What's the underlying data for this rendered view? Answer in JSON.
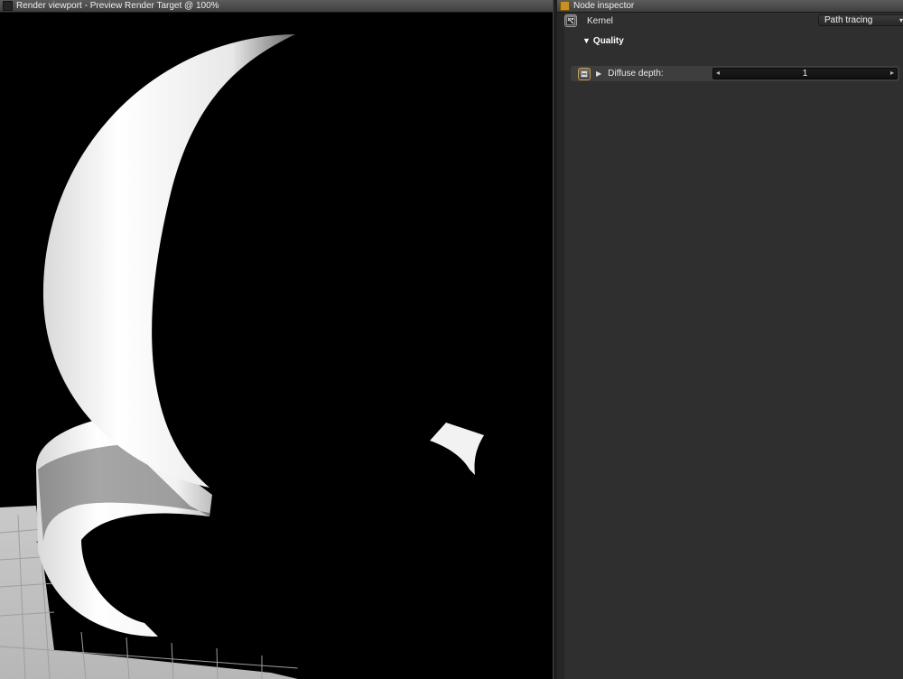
{
  "viewport": {
    "title": "Render viewport - Preview Render Target @ 100%"
  },
  "inspector": {
    "title": "Node inspector",
    "kernel": {
      "label": "Kernel",
      "value": "Path tracing"
    },
    "quality": {
      "label": "Quality"
    },
    "diffuse_depth": {
      "label": "Diffuse depth:",
      "value": "1"
    }
  },
  "icons": {
    "viewport_header": "square-icon",
    "inspector_header": "node-icon",
    "kernel_node": "node-graph-icon",
    "depth_node": "minus-icon",
    "dropdown": "chevron-down-icon",
    "expand": "triangle-right-icon",
    "slider_left": "arrow-left-icon",
    "slider_right": "arrow-right-icon"
  },
  "colors": {
    "accent": "#c8901e",
    "panel_bg": "#2f2f2f",
    "viewport_bg": "#000000"
  }
}
